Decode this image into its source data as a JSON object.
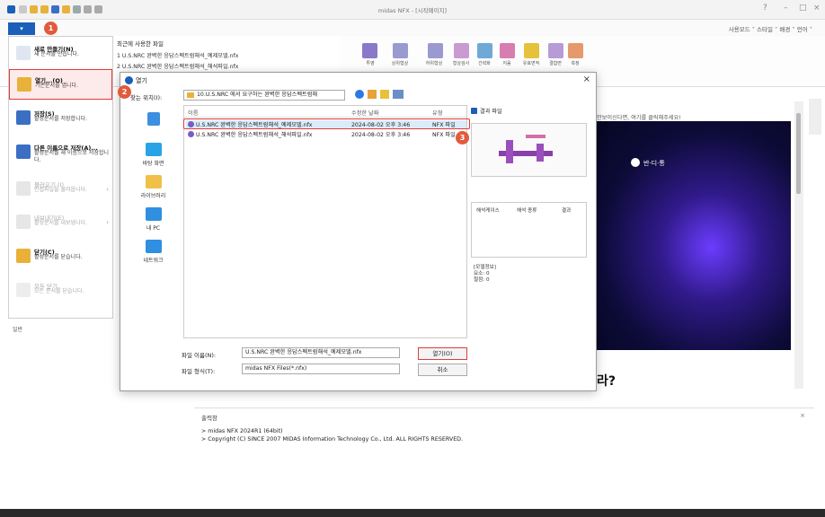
{
  "app": {
    "title": "midas NFX - [시작페이지]",
    "ribbon_right": "사용모드 ˅ 스타일 ˅ 배경 ˅ 언어 ˅",
    "file_menu_button": "▾"
  },
  "ribbon": {
    "labels": [
      "투영",
      "상위형상",
      "하위형상",
      "형상검사",
      "간략화",
      "지움",
      "유효면적",
      "결합면",
      "측정"
    ]
  },
  "file_menu": {
    "items": [
      {
        "title": "새로 만들기(N)",
        "desc": "새 문서를 만듭니다.",
        "enabled": true
      },
      {
        "title": "열기...(O)",
        "desc": "기존문서를 엽니다.",
        "enabled": true
      },
      {
        "title": "저장(S)",
        "desc": "활성문서를 저장합니다.",
        "enabled": true
      },
      {
        "title": "다른 이름으로 저장(A)...",
        "desc": "활성문서를 새 이름으로 저장합니다.",
        "enabled": true
      },
      {
        "title": "불러오기 (I)",
        "desc": "인접파일을 불러옵니다.",
        "enabled": false
      },
      {
        "title": "내보내기(E)",
        "desc": "활성문서를 내보냅니다.",
        "enabled": false
      },
      {
        "title": "닫기(C)",
        "desc": "활성문서를 닫습니다.",
        "enabled": true
      },
      {
        "title": "모두 닫기",
        "desc": "모든 문서를 닫습니다.",
        "enabled": false
      }
    ]
  },
  "recent": {
    "header": "최근에 사용한 파일",
    "items": [
      "1 U.S.NRC 완벽한 응답스펙트럼해석_예제모델.nfx",
      "2 U.S.NRC 완벽한 응답스펙트럼해석_해석파일.nfx"
    ]
  },
  "left_pane_label": "일반",
  "page": {
    "notice": "안보이신다면, 여기를 클릭해주세요!",
    "brand": "반·디·통",
    "headline": "라?"
  },
  "output": {
    "title": "출력창",
    "lines": [
      "> midas NFX 2024R1 (64bit)",
      "> Copyright (C) SINCE 2007 MIDAS Information Technology Co., Ltd. ALL RIGHTS RESERVED."
    ]
  },
  "dialog": {
    "title": "열기",
    "look_in_label": "찾는 위치(I):",
    "look_in_value": "10.U.S.NRC 에서 요구하는 완벽한 응답스펙트럼해",
    "places": [
      "바탕 화면",
      "라이브러리",
      "내 PC",
      "네트워크"
    ],
    "columns": {
      "name": "이름",
      "date": "수정한 날짜",
      "type": "유형"
    },
    "files": [
      {
        "name": "U.S.NRC 완벽한 응답스펙트럼해석_예제모델.nfx",
        "date": "2024-08-02 오후 3:46",
        "type": "NFX 파일"
      },
      {
        "name": "U.S.NRC 완벽한 응답스펙트럼해석_해석파일.nfx",
        "date": "2024-08-02 오후 3:46",
        "type": "NFX 파일"
      }
    ],
    "result_file_label": "결과 파일",
    "result_cols": [
      "해석케이스",
      "해석 종류",
      "결과"
    ],
    "model_info": [
      "[모델정보]",
      "요소:   0",
      "절점:   0"
    ],
    "file_name_label": "파일 이름(N):",
    "file_name_value": "U.S.NRC 완벽한 응답스펙트럼해석_예제모델.nfx",
    "file_type_label": "파일 형식(T):",
    "file_type_value": "midas NFX Files(*.nfx)",
    "open_button": "열기(O)",
    "cancel_button": "취소"
  },
  "badges": [
    "1",
    "2",
    "3"
  ],
  "colors": {
    "accent": "#1b5fb8",
    "badge": "#e25a3c",
    "highlight": "#e03b3b"
  }
}
